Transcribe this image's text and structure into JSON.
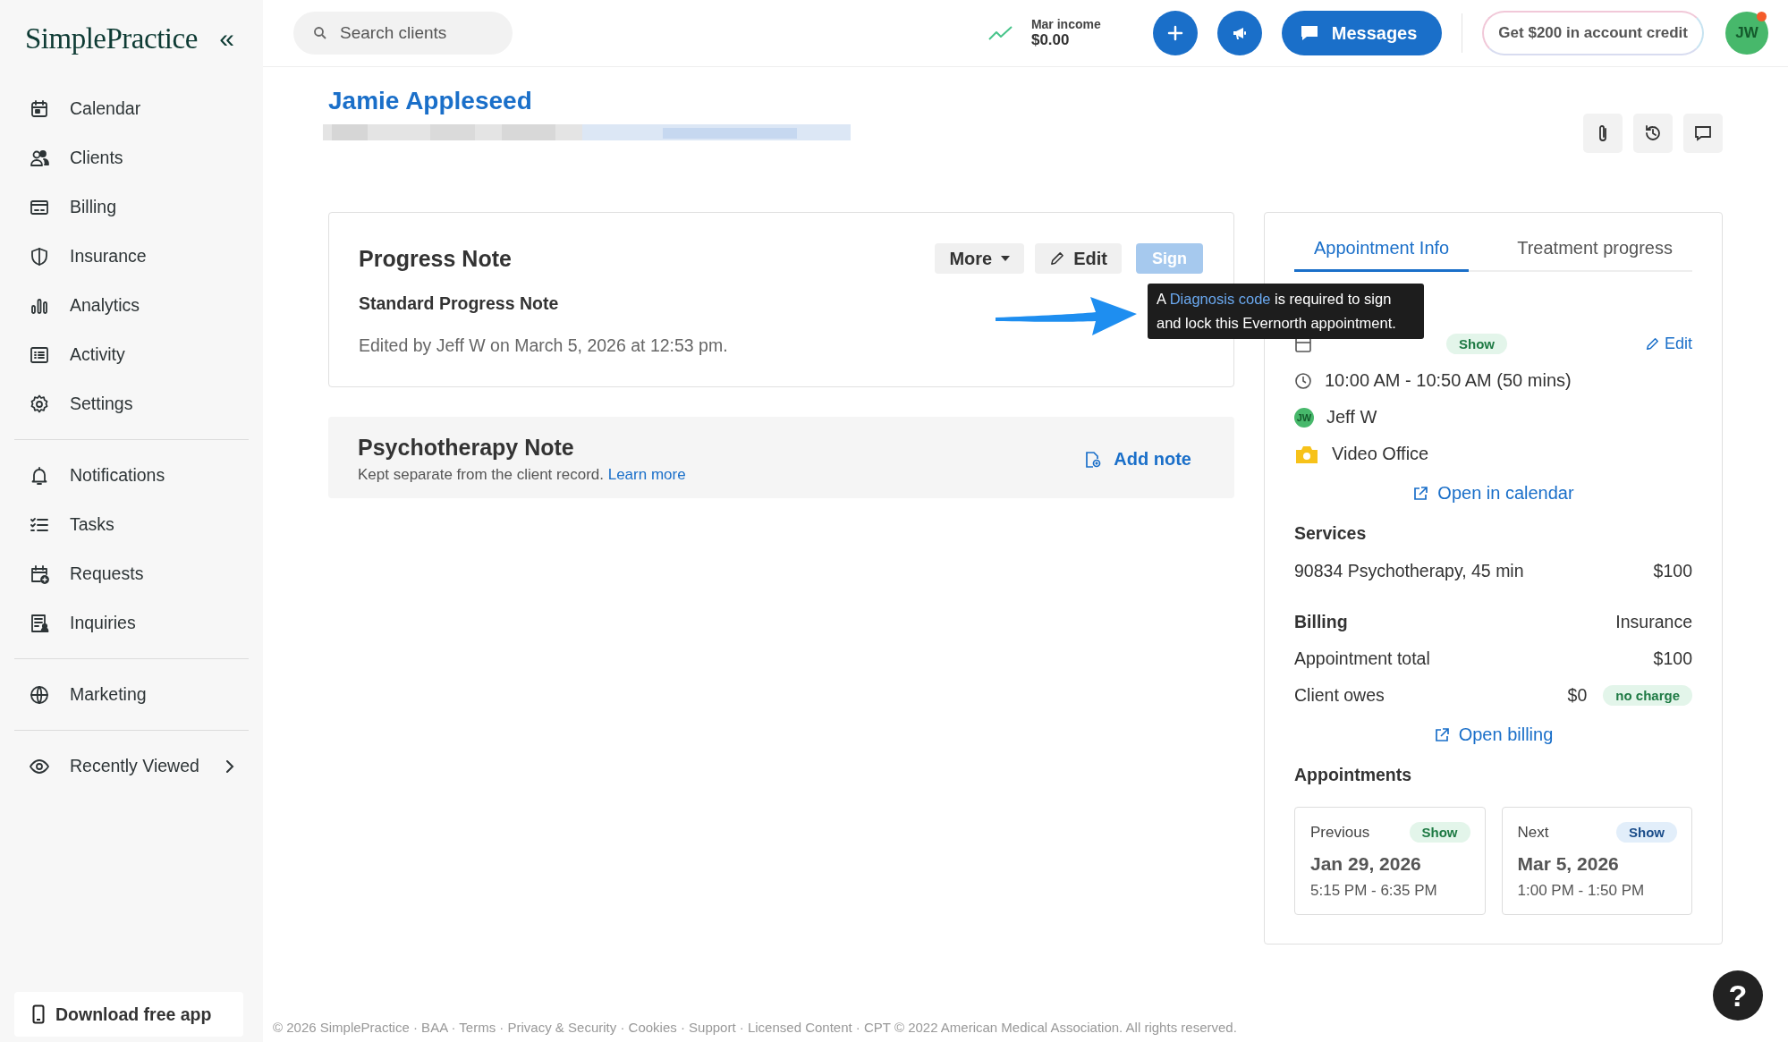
{
  "sidebar": {
    "logo": "SimplePractice",
    "collapse_icon": "«",
    "groups": [
      {
        "items": [
          {
            "label": "Calendar",
            "selected": false
          },
          {
            "label": "Clients",
            "selected": false
          },
          {
            "label": "Billing",
            "selected": false
          },
          {
            "label": "Insurance",
            "selected": false
          },
          {
            "label": "Analytics",
            "selected": false
          },
          {
            "label": "Activity",
            "selected": false
          },
          {
            "label": "Settings",
            "selected": false
          }
        ]
      },
      {
        "items": [
          {
            "label": "Notifications",
            "selected": false
          },
          {
            "label": "Tasks",
            "selected": false
          },
          {
            "label": "Requests",
            "selected": false
          },
          {
            "label": "Inquiries",
            "selected": false
          }
        ]
      },
      {
        "items": [
          {
            "label": "Marketing",
            "selected": false
          }
        ]
      },
      {
        "items": [
          {
            "label": "Recently Viewed",
            "selected": false,
            "expandable": true
          }
        ]
      }
    ],
    "download_button": "Download free app"
  },
  "header": {
    "search": {
      "placeholder": "Search clients"
    },
    "income": {
      "label": "Mar income",
      "value": "$0.00"
    },
    "messages_button": "Messages",
    "credit_button": "Get $200 in account credit",
    "avatar": {
      "initials": "JW",
      "has_notification": true
    }
  },
  "client": {
    "name": "Jamie Appleseed"
  },
  "progress_note": {
    "title": "Progress Note",
    "buttons": {
      "more": "More",
      "edit": "Edit",
      "sign": "Sign"
    },
    "sign_disabled": true,
    "subtitle": "Standard Progress Note",
    "edited": "Edited by Jeff W on March 5, 2026 at 12:53 pm.",
    "tooltip": {
      "before": "A",
      "link": "Diagnosis code",
      "after": "is required to sign and lock this Evernorth appointment."
    }
  },
  "psychotherapy_note": {
    "title": "Psychotherapy Note",
    "description": "Kept separate from the client record.",
    "link": "Learn more",
    "action": "Add note"
  },
  "appointment_panel": {
    "tabs": [
      {
        "label": "Appointment Info",
        "selected": true
      },
      {
        "label": "Treatment progress",
        "selected": false
      }
    ],
    "status_badge": "Show",
    "edit_link": "Edit",
    "time": "10:00 AM - 10:50 AM (50 mins)",
    "clinician": {
      "initials": "JW",
      "name": "Jeff W"
    },
    "location": "Video Office",
    "calendar_link": "Open in calendar",
    "services_heading": "Services",
    "service": {
      "name": "90834 Psychotherapy, 45 min",
      "price": "$100"
    },
    "billing_heading": "Billing",
    "billing_type": "Insurance",
    "total": {
      "label": "Appointment total",
      "value": "$100"
    },
    "client_owes": {
      "label": "Client owes",
      "value": "$0",
      "badge": "no charge"
    },
    "billing_link": "Open billing",
    "appointments_heading": "Appointments",
    "appointments": [
      {
        "label": "Previous",
        "badge": "Show",
        "color": "#e3f5ea",
        "date": "Jan 29, 2026",
        "time": "5:15 PM - 6:35 PM"
      },
      {
        "label": "Next",
        "badge": "Show",
        "color": "#e2eefa",
        "date": "Mar 5, 2026",
        "time": "1:00 PM - 1:50 PM"
      }
    ]
  },
  "footer": "© 2026 SimplePractice · BAA · Terms · Privacy & Security · Cookies · Support · Licensed Content · CPT © 2022 American Medical Association. All rights reserved.",
  "help_button": "?"
}
